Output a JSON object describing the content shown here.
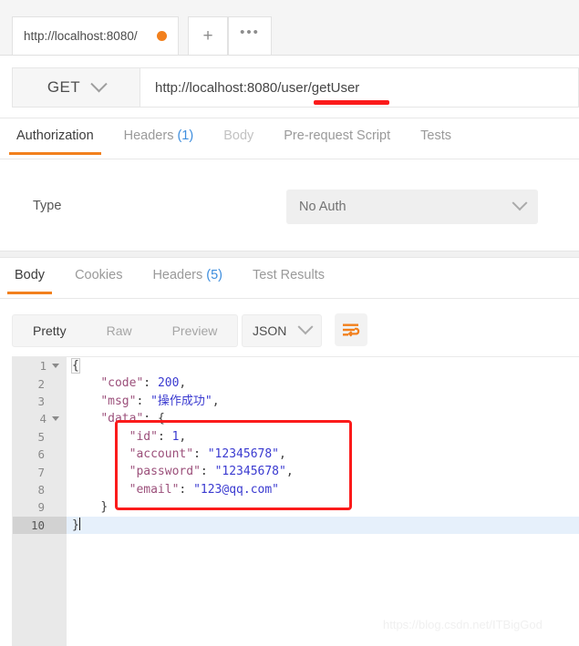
{
  "tabstrip": {
    "request_tab_label": "http://localhost:8080/",
    "unsaved_indicator": "unsaved-dot",
    "new_tab_label": "+",
    "more_label": "•••"
  },
  "url_bar": {
    "method": "GET",
    "method_chevron": "chevron-down-icon",
    "url": "http://localhost:8080/user/getUser"
  },
  "request_tabs": [
    {
      "label": "Authorization",
      "active": true,
      "dim": false,
      "count": ""
    },
    {
      "label": "Headers",
      "active": false,
      "dim": false,
      "count": "(1)"
    },
    {
      "label": "Body",
      "active": false,
      "dim": true,
      "count": ""
    },
    {
      "label": "Pre-request Script",
      "active": false,
      "dim": false,
      "count": ""
    },
    {
      "label": "Tests",
      "active": false,
      "dim": false,
      "count": ""
    }
  ],
  "auth": {
    "type_label": "Type",
    "selected_type": "No Auth",
    "chevron": "chevron-down-icon"
  },
  "response_tabs": [
    {
      "label": "Body",
      "active": true,
      "dim": false,
      "count": ""
    },
    {
      "label": "Cookies",
      "active": false,
      "dim": false,
      "count": ""
    },
    {
      "label": "Headers",
      "active": false,
      "dim": false,
      "count": "(5)"
    },
    {
      "label": "Test Results",
      "active": false,
      "dim": false,
      "count": ""
    }
  ],
  "body_toolbar": {
    "view_modes": [
      {
        "label": "Pretty",
        "active": true
      },
      {
        "label": "Raw",
        "active": false
      },
      {
        "label": "Preview",
        "active": false
      }
    ],
    "format": "JSON",
    "format_chevron": "chevron-down-icon",
    "wrap_icon": "word-wrap-icon"
  },
  "editor": {
    "gutter": [
      {
        "num": "1",
        "fold": true,
        "active": false
      },
      {
        "num": "2",
        "fold": false,
        "active": false
      },
      {
        "num": "3",
        "fold": false,
        "active": false
      },
      {
        "num": "4",
        "fold": true,
        "active": false
      },
      {
        "num": "5",
        "fold": false,
        "active": false
      },
      {
        "num": "6",
        "fold": false,
        "active": false
      },
      {
        "num": "7",
        "fold": false,
        "active": false
      },
      {
        "num": "8",
        "fold": false,
        "active": false
      },
      {
        "num": "9",
        "fold": false,
        "active": false
      },
      {
        "num": "10",
        "fold": false,
        "active": true
      }
    ],
    "lines": [
      {
        "indent": "",
        "key": "",
        "sep": "",
        "value": "{",
        "value_type": "punct",
        "trail": "",
        "active": false,
        "brace": true
      },
      {
        "indent": "    ",
        "key": "\"code\"",
        "sep": ": ",
        "value": "200",
        "value_type": "number",
        "trail": ",",
        "active": false,
        "brace": false
      },
      {
        "indent": "    ",
        "key": "\"msg\"",
        "sep": ": ",
        "value": "\"操作成功\"",
        "value_type": "string",
        "trail": ",",
        "active": false,
        "brace": false
      },
      {
        "indent": "    ",
        "key": "\"data\"",
        "sep": ": ",
        "value": "{",
        "value_type": "punct",
        "trail": "",
        "active": false,
        "brace": false
      },
      {
        "indent": "        ",
        "key": "\"id\"",
        "sep": ": ",
        "value": "1",
        "value_type": "number",
        "trail": ",",
        "active": false,
        "brace": false
      },
      {
        "indent": "        ",
        "key": "\"account\"",
        "sep": ": ",
        "value": "\"12345678\"",
        "value_type": "string",
        "trail": ",",
        "active": false,
        "brace": false
      },
      {
        "indent": "        ",
        "key": "\"password\"",
        "sep": ": ",
        "value": "\"12345678\"",
        "value_type": "string",
        "trail": ",",
        "active": false,
        "brace": false
      },
      {
        "indent": "        ",
        "key": "\"email\"",
        "sep": ": ",
        "value": "\"123@qq.com\"",
        "value_type": "string",
        "trail": "",
        "active": false,
        "brace": false
      },
      {
        "indent": "    ",
        "key": "",
        "sep": "",
        "value": "}",
        "value_type": "punct",
        "trail": "",
        "active": false,
        "brace": false
      },
      {
        "indent": "",
        "key": "",
        "sep": "",
        "value": "}",
        "value_type": "punct",
        "trail": "",
        "active": true,
        "brace": false
      }
    ],
    "response_json": {
      "code": 200,
      "msg": "操作成功",
      "data": {
        "id": 1,
        "account": "12345678",
        "password": "12345678",
        "email": "123@qq.com"
      }
    }
  },
  "annotations": {
    "url_underline_color": "#fb1b1b",
    "highlight_box_color": "#fb1b1b",
    "highlight_box_target": "data-object-fields"
  },
  "watermark": {
    "text": "https://blog.csdn.net/ITBigGod"
  },
  "colors": {
    "accent_orange": "#f2801d",
    "link_blue": "#3e8ede",
    "json_key": "#9b4f7a",
    "json_value": "#3a3ad0",
    "annotation_red": "#fb1b1b"
  }
}
